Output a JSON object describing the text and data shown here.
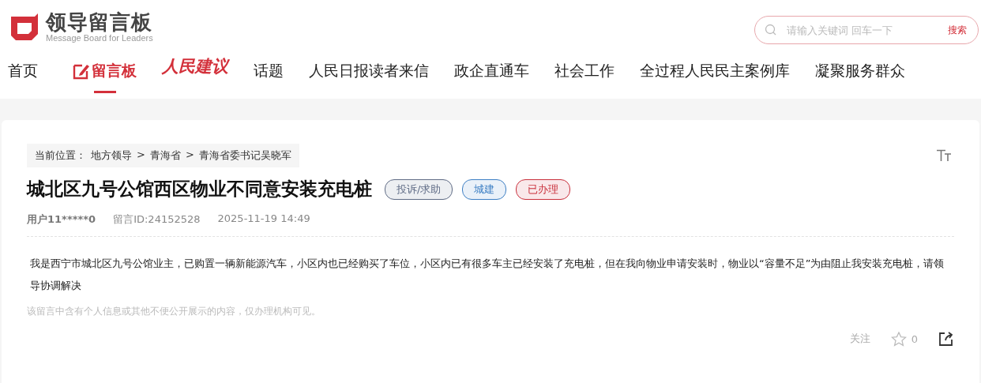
{
  "logo": {
    "title": "领导留言板",
    "subtitle": "Message Board for Leaders"
  },
  "search": {
    "placeholder": "请输入关键词 回车一下",
    "button": "搜索"
  },
  "nav": [
    {
      "label": "首页",
      "kind": "text",
      "selected": false
    },
    {
      "label": "留言板",
      "kind": "icon-text",
      "selected": true
    },
    {
      "label": "人民建议",
      "kind": "logo-text",
      "selected": false
    },
    {
      "label": "话题",
      "kind": "text",
      "selected": false
    },
    {
      "label": "人民日报读者来信",
      "kind": "text",
      "selected": false
    },
    {
      "label": "政企直通车",
      "kind": "text",
      "selected": false
    },
    {
      "label": "社会工作",
      "kind": "text",
      "selected": false
    },
    {
      "label": "全过程人民民主案例库",
      "kind": "text",
      "selected": false
    },
    {
      "label": "凝聚服务群众",
      "kind": "text",
      "selected": false
    }
  ],
  "breadcrumb": {
    "prefix": "当前位置：",
    "items": [
      "地方领导",
      "青海省",
      "青海省委书记吴晓军"
    ],
    "separator": ">"
  },
  "message": {
    "title": "城北区九号公馆西区物业不同意安装充电桩",
    "tags": [
      {
        "label": "投诉/求助",
        "color": "#5f6b85"
      },
      {
        "label": "城建",
        "color": "#3d7fc4"
      },
      {
        "label": "已办理",
        "color": "#c9303c"
      }
    ],
    "user": "用户11*****0",
    "id": "留言ID:24152528",
    "time": "2025-11-19 14:49",
    "body": "我是西宁市城北区九号公馆业主，已购置一辆新能源汽车，小区内也已经购买了车位，小区内已有很多车主已经安装了充电桩，但在我向物业申请安装时，物业以“容量不足”为由阻止我安装充电桩，请领导协调解决",
    "notice": "该留言中含有个人信息或其他不便公开展示的内容，仅办理机构可见。",
    "follow": "关注",
    "likes": "0"
  }
}
